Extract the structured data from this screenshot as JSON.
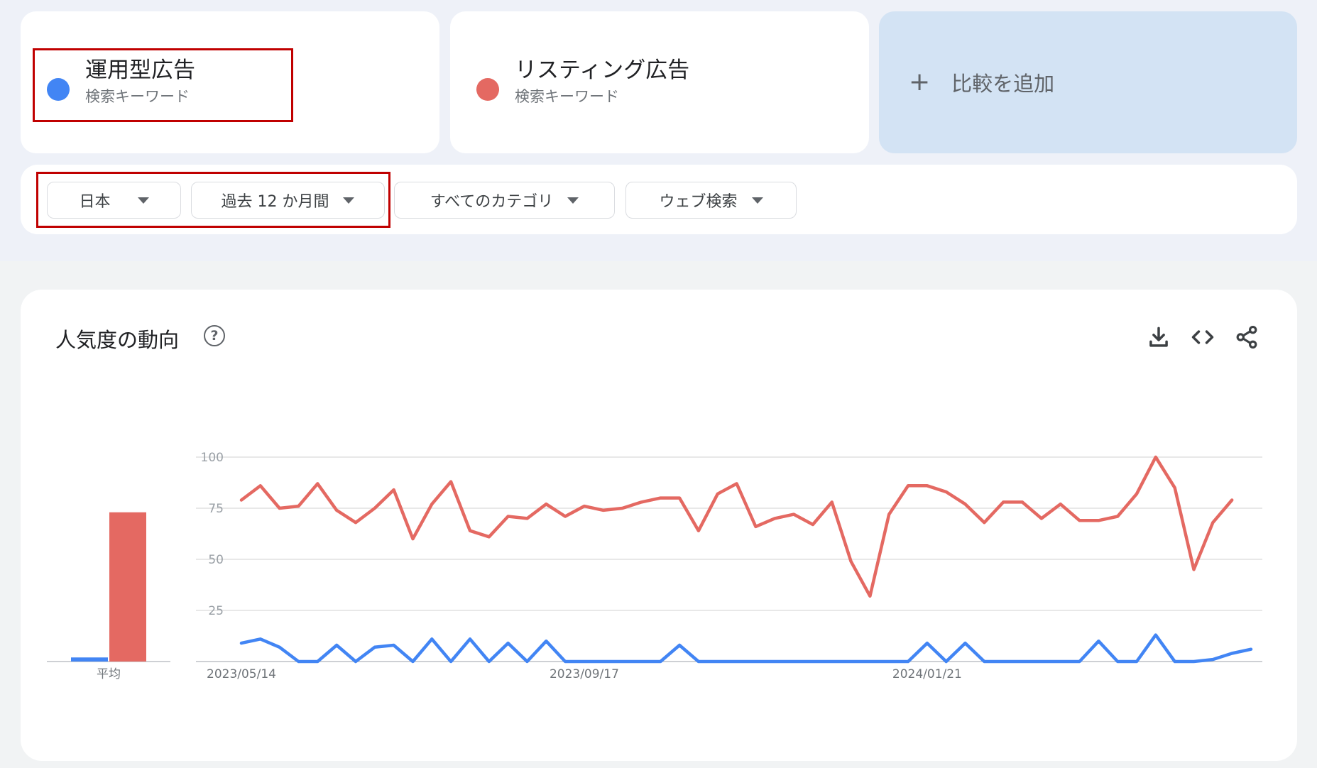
{
  "terms": [
    {
      "name": "運用型広告",
      "subtitle": "検索キーワード",
      "color": "#4285f4"
    },
    {
      "name": "リスティング広告",
      "subtitle": "検索キーワード",
      "color": "#e46962"
    }
  ],
  "add_compare": {
    "icon": "plus-icon",
    "label": "比較を追加"
  },
  "filters": [
    {
      "label": "日本"
    },
    {
      "label": "過去 12 か月間"
    },
    {
      "label": "すべてのカテゴリ"
    },
    {
      "label": "ウェブ検索"
    }
  ],
  "chart_section": {
    "title": "人気度の動向",
    "help_icon_glyph": "?",
    "tools": [
      "download-icon",
      "embed-code-icon",
      "share-icon"
    ]
  },
  "chart_data": {
    "type": "line",
    "y_ticks": [
      100,
      75,
      50,
      25
    ],
    "ylim": [
      0,
      100
    ],
    "x_tick_labels": [
      "2023/05/14",
      "2023/09/17",
      "2024/01/21"
    ],
    "x_tick_indices": [
      0,
      18,
      36
    ],
    "average_label": "平均",
    "averages": [
      2,
      73
    ],
    "series": [
      {
        "color": "#4285f4",
        "values": [
          9,
          11,
          7,
          0,
          0,
          8,
          0,
          7,
          8,
          0,
          11,
          0,
          11,
          0,
          9,
          0,
          10,
          0,
          0,
          0,
          0,
          0,
          0,
          8,
          0,
          0,
          0,
          0,
          0,
          0,
          0,
          0,
          0,
          0,
          0,
          0,
          9,
          0,
          9,
          0,
          0,
          0,
          0,
          0,
          0,
          10,
          0,
          0,
          13,
          0,
          0,
          1,
          4,
          6
        ]
      },
      {
        "color": "#e46962",
        "values": [
          79,
          86,
          75,
          76,
          87,
          74,
          68,
          75,
          84,
          60,
          77,
          88,
          64,
          61,
          71,
          70,
          77,
          71,
          76,
          74,
          75,
          78,
          80,
          80,
          64,
          82,
          87,
          66,
          70,
          72,
          67,
          78,
          49,
          32,
          72,
          86,
          86,
          83,
          77,
          68,
          78,
          78,
          70,
          77,
          69,
          69,
          71,
          82,
          100,
          85,
          45,
          68,
          79
        ]
      }
    ]
  }
}
